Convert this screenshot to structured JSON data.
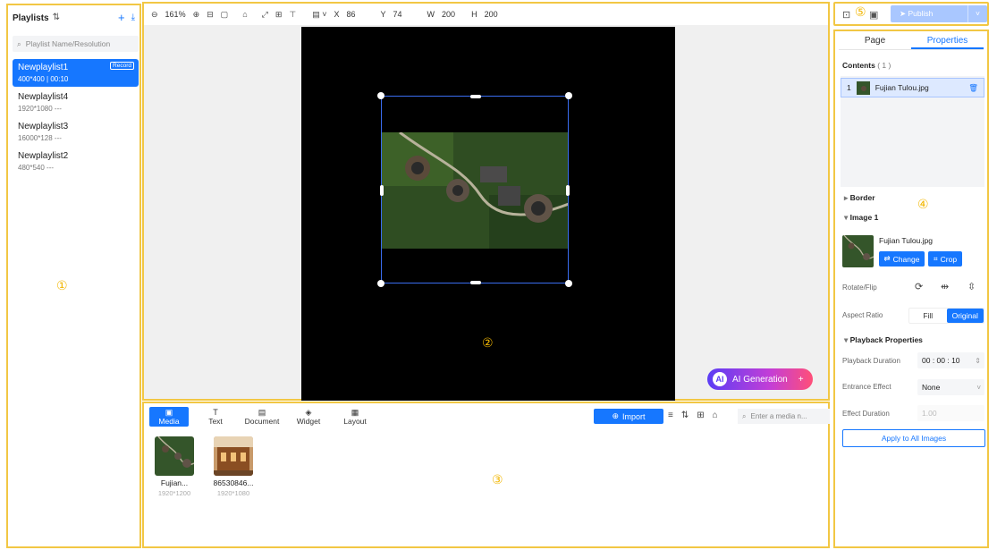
{
  "panel_numbers": {
    "p1": "①",
    "p2": "②",
    "p3": "③",
    "p4": "④",
    "p5": "⑤"
  },
  "playlists": {
    "title": "Playlists",
    "search_placeholder": "Playlist Name/Resolution",
    "items": [
      {
        "name": "Newplaylist1",
        "meta": "400*400 | 00:10",
        "badge": "Record",
        "selected": true
      },
      {
        "name": "Newplaylist4",
        "meta": "1920*1080 ---",
        "selected": false
      },
      {
        "name": "Newplaylist3",
        "meta": "16000*128 ---",
        "selected": false
      },
      {
        "name": "Newplaylist2",
        "meta": "480*540 ---",
        "selected": false
      }
    ]
  },
  "toolbar": {
    "zoom": "161%",
    "x_label": "X",
    "x_value": "86",
    "y_label": "Y",
    "y_value": "74",
    "w_label": "W",
    "w_value": "200",
    "h_label": "H",
    "h_value": "200"
  },
  "ai_button": "AI Generation",
  "media_panel": {
    "tabs": [
      "Media",
      "Text",
      "Document",
      "Widget",
      "Layout"
    ],
    "import_label": "Import",
    "search_placeholder": "Enter a media n...",
    "items": [
      {
        "name": "Fujian...",
        "size": "1920*1200"
      },
      {
        "name": "86530846...",
        "size": "1920*1080"
      }
    ]
  },
  "publish": {
    "label": "Publish"
  },
  "properties": {
    "tabs": [
      "Page",
      "Properties"
    ],
    "contents_label": "Contents",
    "contents_count": "( 1 )",
    "content_item": {
      "index": "1",
      "name": "Fujian Tulou.jpg"
    },
    "border_label": "Border",
    "image_label": "Image 1",
    "image_name": "Fujian Tulou.jpg",
    "change_label": "Change",
    "crop_label": "Crop",
    "rotate_label": "Rotate/Flip",
    "aspect_label": "Aspect Ratio",
    "aspect_options": [
      "Fill",
      "Original"
    ],
    "playback_label": "Playback Properties",
    "duration_label": "Playback Duration",
    "duration_value": "00 : 00 : 10",
    "entrance_label": "Entrance Effect",
    "entrance_value": "None",
    "effect_duration_label": "Effect Duration",
    "effect_duration_value": "1.00",
    "apply_label": "Apply to All Images"
  },
  "colors": {
    "accent": "#1677ff",
    "zone_border": "#f2c744"
  }
}
